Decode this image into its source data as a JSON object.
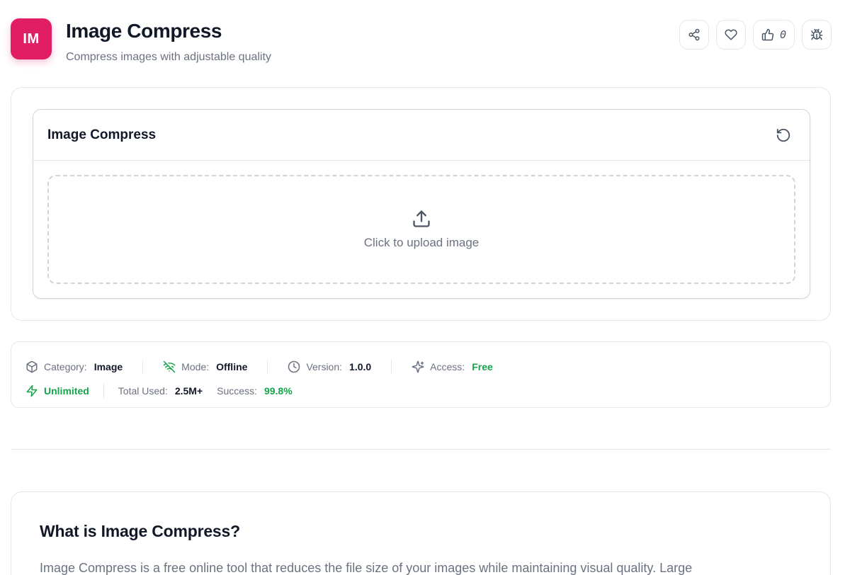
{
  "app": {
    "logo_text": "IM",
    "title": "Image Compress",
    "subtitle": "Compress images with adjustable quality",
    "brand_color": "#e11d63"
  },
  "header_actions": {
    "share_icon": "share-icon",
    "favorite_icon": "heart-icon",
    "like_icon": "thumbs-up-icon",
    "like_count": "0",
    "report_icon": "bug-icon"
  },
  "tool": {
    "title": "Image Compress",
    "reset_icon": "reset-icon",
    "upload_icon": "upload-icon",
    "upload_text": "Click to upload image"
  },
  "meta": {
    "category_label": "Category:",
    "category_value": "Image",
    "mode_label": "Mode:",
    "mode_value": "Offline",
    "version_label": "Version:",
    "version_value": "1.0.0",
    "access_label": "Access:",
    "access_value": "Free",
    "unlimited_label": "Unlimited",
    "total_used_label": "Total Used:",
    "total_used_value": "2.5M+",
    "success_label": "Success:",
    "success_value": "99.8%",
    "accent_green": "#16a34a"
  },
  "about": {
    "heading": "What is Image Compress?",
    "body": "Image Compress is a free online tool that reduces the file size of your images while maintaining visual quality. Large"
  }
}
